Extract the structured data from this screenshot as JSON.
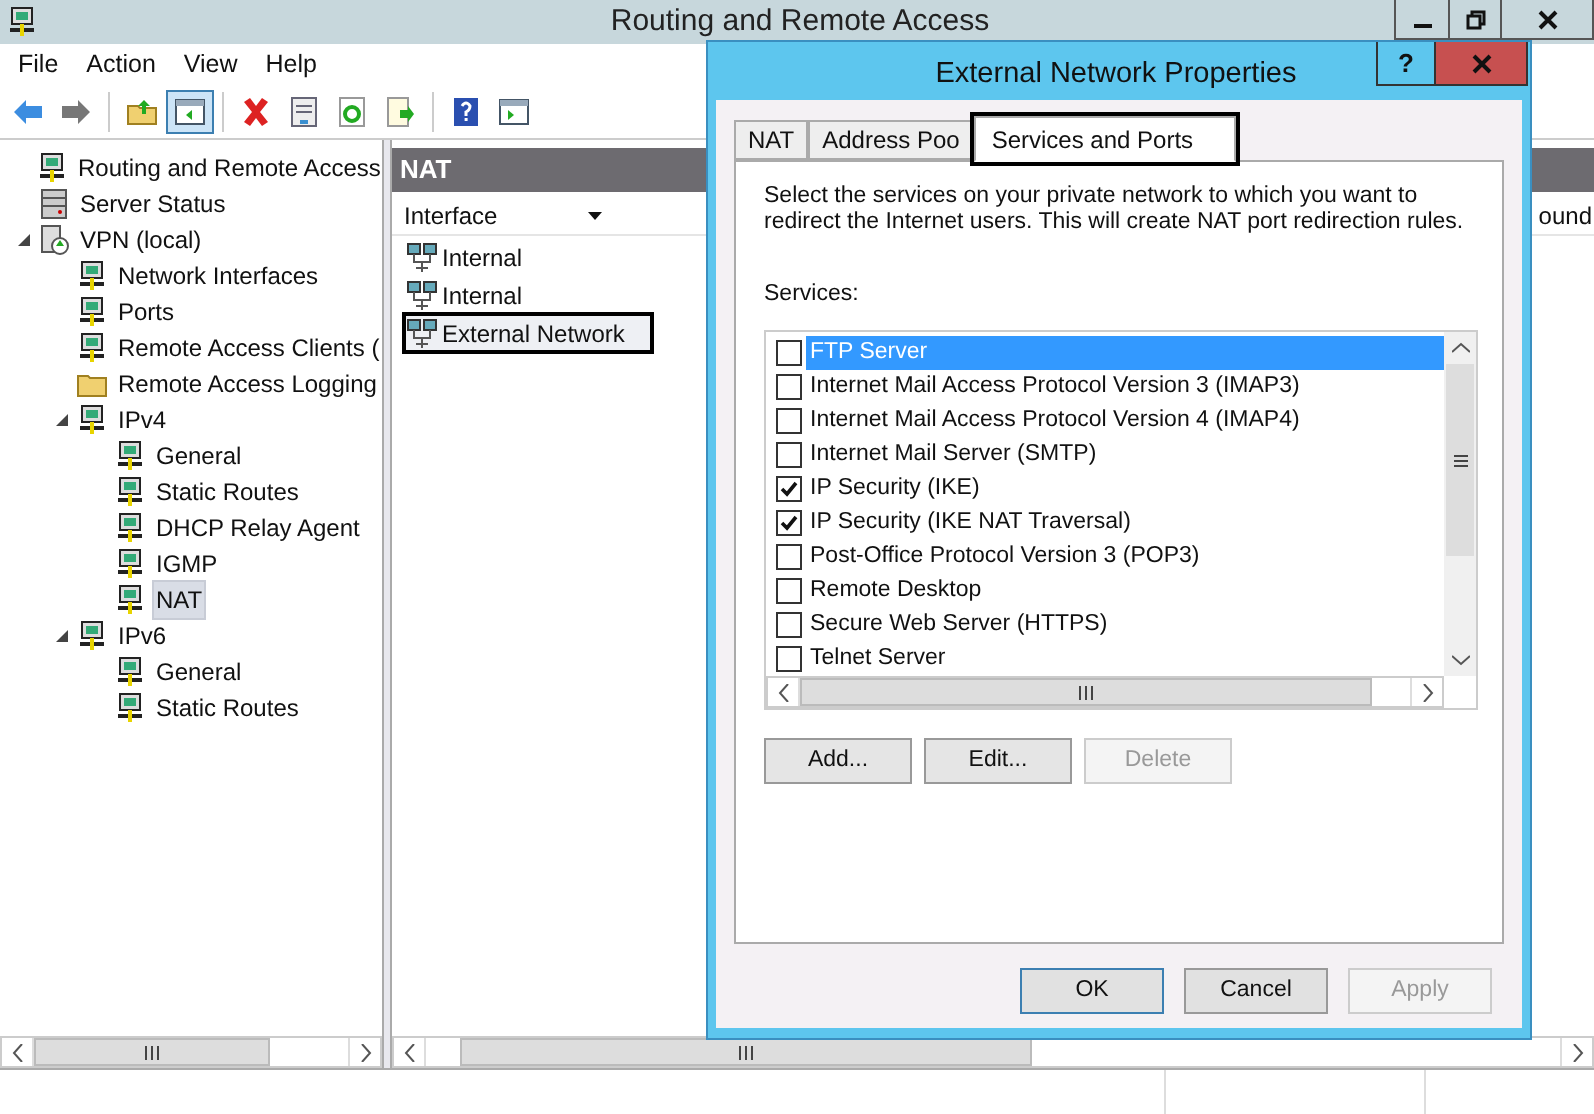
{
  "window": {
    "title": "Routing and Remote Access"
  },
  "menu": [
    "File",
    "Action",
    "View",
    "Help"
  ],
  "toolbar": [
    [
      {
        "kind": "back"
      },
      {
        "kind": "forward"
      }
    ],
    [
      {
        "kind": "up"
      },
      {
        "kind": "pane",
        "pressed": true
      }
    ],
    [
      {
        "kind": "delete"
      },
      {
        "kind": "properties"
      },
      {
        "kind": "refresh"
      },
      {
        "kind": "export"
      }
    ],
    [
      {
        "kind": "help"
      },
      {
        "kind": "action"
      }
    ]
  ],
  "tree": [
    {
      "label": "Routing and Remote Access",
      "kind": "server",
      "selected": false,
      "children": [
        {
          "label": "Server Status",
          "kind": "status",
          "selected": false
        },
        {
          "label": "VPN (local)",
          "kind": "vpn",
          "selected": false,
          "expanded": true,
          "children": [
            {
              "label": "Network Interfaces",
              "kind": "node",
              "selected": false
            },
            {
              "label": "Ports",
              "kind": "node",
              "selected": false
            },
            {
              "label": "Remote Access Clients (",
              "kind": "node",
              "selected": false
            },
            {
              "label": "Remote Access Logging",
              "kind": "folder",
              "selected": false
            },
            {
              "label": "IPv4",
              "kind": "node",
              "selected": false,
              "expanded": true,
              "children": [
                {
                  "label": "General",
                  "kind": "node",
                  "selected": false
                },
                {
                  "label": "Static Routes",
                  "kind": "node",
                  "selected": false
                },
                {
                  "label": "DHCP Relay Agent",
                  "kind": "node",
                  "selected": false
                },
                {
                  "label": "IGMP",
                  "kind": "node",
                  "selected": false
                },
                {
                  "label": "NAT",
                  "kind": "node",
                  "selected": true
                }
              ]
            },
            {
              "label": "IPv6",
              "kind": "node",
              "selected": false,
              "expanded": true,
              "children": [
                {
                  "label": "General",
                  "kind": "node",
                  "selected": false
                },
                {
                  "label": "Static Routes",
                  "kind": "node",
                  "selected": false
                }
              ]
            }
          ]
        }
      ]
    }
  ],
  "details": {
    "title": "NAT",
    "columns": [
      "Interface",
      "ound"
    ],
    "rows": [
      {
        "label": "Internal",
        "highlighted": false
      },
      {
        "label": "Internal",
        "highlighted": false
      },
      {
        "label": "External Network",
        "highlighted": true
      }
    ]
  },
  "dialog": {
    "title": "External Network Properties",
    "help": "?",
    "tabs": [
      {
        "label": "NAT",
        "selected": false,
        "highlighted": false
      },
      {
        "label": "Address Poo",
        "selected": false,
        "highlighted": false
      },
      {
        "label": "Services and Ports",
        "selected": true,
        "highlighted": true
      }
    ],
    "description": "Select the services on your private network to which you want to redirect the Internet users. This will create NAT port redirection rules.",
    "services_label": "Services:",
    "services": [
      {
        "label": "FTP Server",
        "checked": false,
        "selected": true
      },
      {
        "label": "Internet Mail Access Protocol Version 3 (IMAP3)",
        "checked": false,
        "selected": false
      },
      {
        "label": "Internet Mail Access Protocol Version 4 (IMAP4)",
        "checked": false,
        "selected": false
      },
      {
        "label": "Internet Mail Server (SMTP)",
        "checked": false,
        "selected": false
      },
      {
        "label": "IP Security (IKE)",
        "checked": true,
        "selected": false
      },
      {
        "label": "IP Security (IKE NAT Traversal)",
        "checked": true,
        "selected": false
      },
      {
        "label": "Post-Office Protocol Version 3 (POP3)",
        "checked": false,
        "selected": false
      },
      {
        "label": "Remote Desktop",
        "checked": false,
        "selected": false
      },
      {
        "label": "Secure Web Server (HTTPS)",
        "checked": false,
        "selected": false
      },
      {
        "label": "Telnet Server",
        "checked": false,
        "selected": false
      }
    ],
    "list_buttons": [
      {
        "label": "Add...",
        "disabled": false
      },
      {
        "label": "Edit...",
        "disabled": false
      },
      {
        "label": "Delete",
        "disabled": true
      }
    ],
    "buttons": [
      {
        "label": "OK",
        "disabled": false,
        "default": true
      },
      {
        "label": "Cancel",
        "disabled": false,
        "default": false
      },
      {
        "label": "Apply",
        "disabled": true,
        "default": false
      }
    ]
  }
}
